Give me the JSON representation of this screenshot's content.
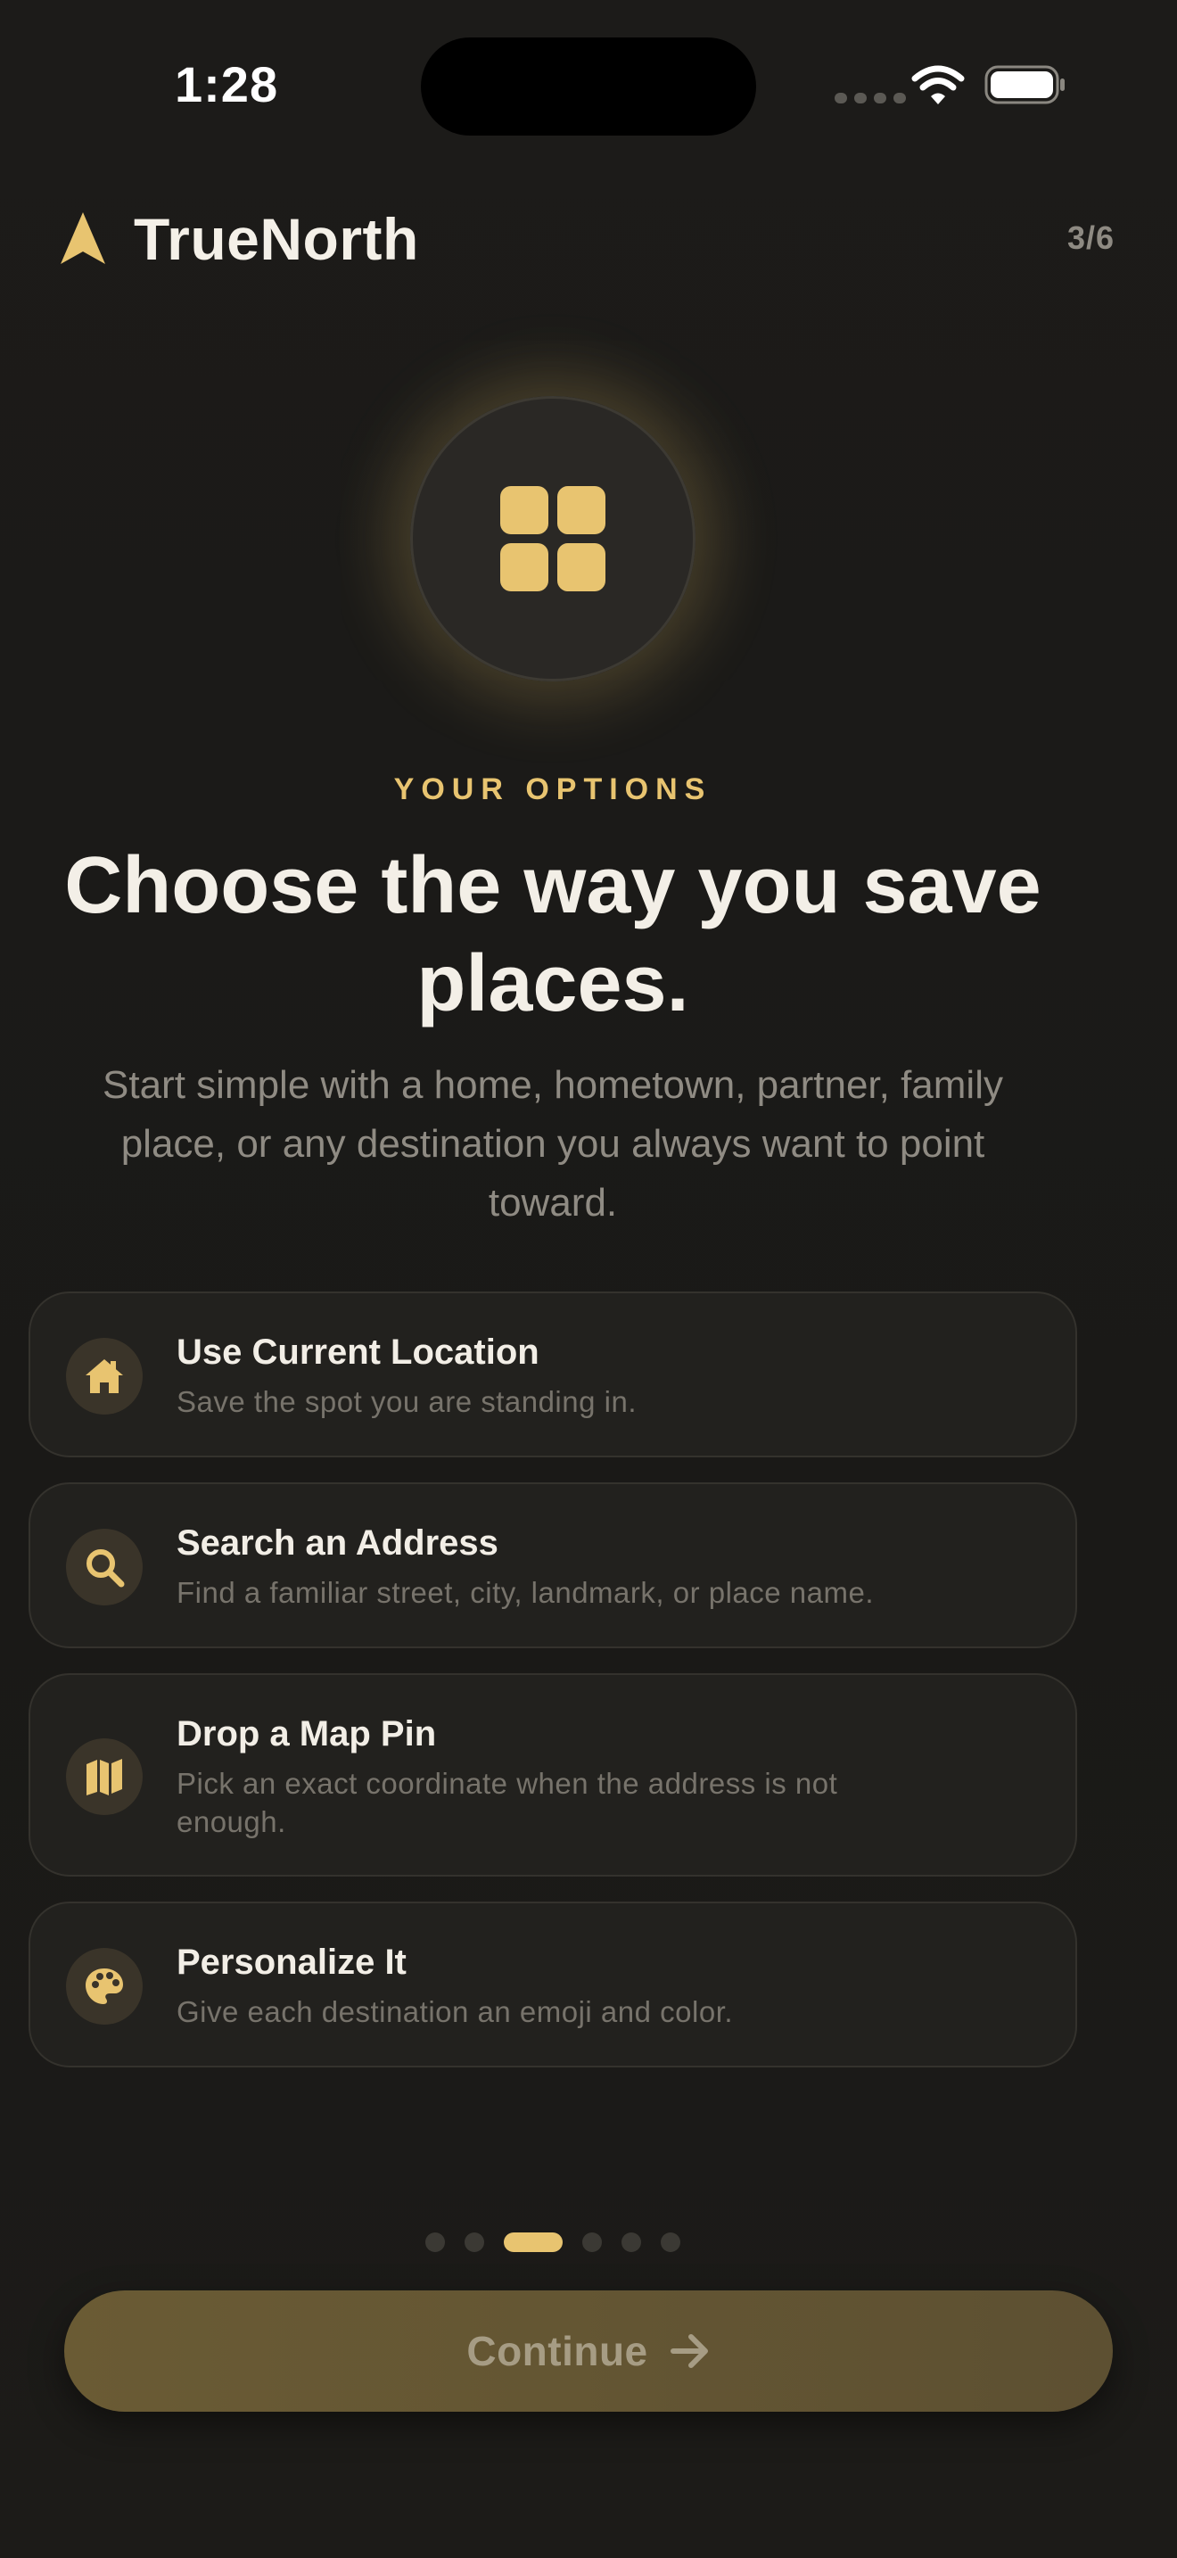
{
  "status_bar": {
    "time": "1:28"
  },
  "header": {
    "app_name": "TrueNorth",
    "step": "3/6"
  },
  "hero": {
    "eyebrow": "YOUR OPTIONS",
    "headline": "Choose the way you save places.",
    "subtitle": "Start simple with a home, hometown, partner, family place, or any destination you always want to point toward."
  },
  "options": [
    {
      "title": "Use Current Location",
      "description": "Save the spot you are standing in.",
      "icon": "house-icon"
    },
    {
      "title": "Search an Address",
      "description": "Find a familiar street, city, landmark, or place name.",
      "icon": "magnifier-icon"
    },
    {
      "title": "Drop a Map Pin",
      "description": "Pick an exact coordinate when the address is not enough.",
      "icon": "map-icon"
    },
    {
      "title": "Personalize It",
      "description": "Give each destination an emoji and color.",
      "icon": "palette-icon"
    }
  ],
  "pagination": {
    "total": 6,
    "current": 3
  },
  "cta": {
    "label": "Continue"
  },
  "colors": {
    "accent": "#e8c470",
    "background": "#1b1a18",
    "card": "#22211e",
    "cta": "#6a5b34"
  }
}
